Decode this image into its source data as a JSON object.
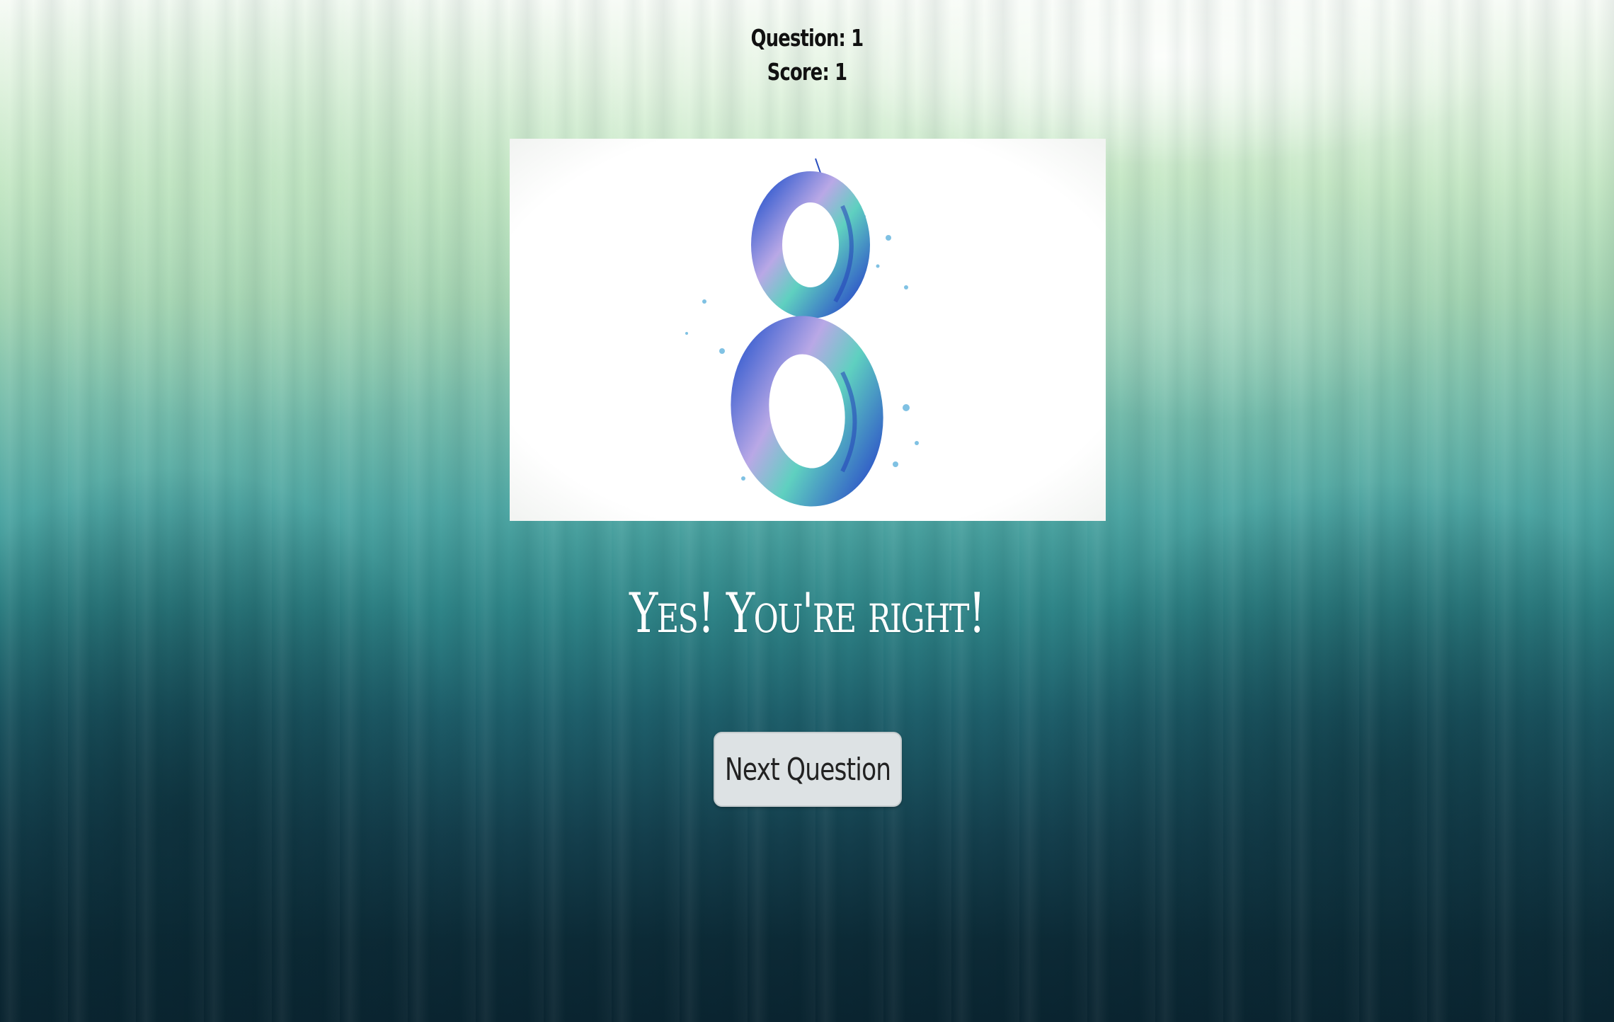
{
  "header": {
    "question_label": "Question: 1",
    "score_label": "Score: 1"
  },
  "image": {
    "depicted_digit": "8",
    "colors": {
      "blue": "#2f56c8",
      "teal": "#5fd0c0",
      "lilac": "#b9a8e6"
    }
  },
  "feedback": {
    "message": "Yes! You're right!"
  },
  "actions": {
    "next_label": "Next Question"
  }
}
